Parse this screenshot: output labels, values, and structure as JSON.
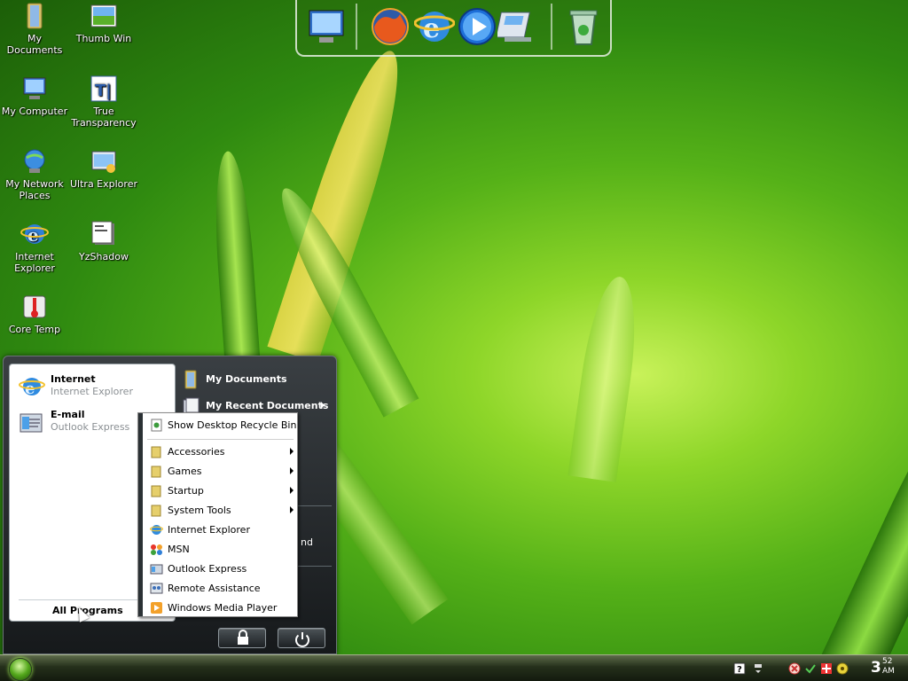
{
  "desktop_icons": [
    {
      "label": "My Documents",
      "icon": "folder-documents-icon"
    },
    {
      "label": "Thumb Win",
      "icon": "picture-icon"
    },
    {
      "label": "My Computer",
      "icon": "computer-icon"
    },
    {
      "label": "True Transparency",
      "icon": "app-icon"
    },
    {
      "label": "My Network Places",
      "icon": "network-icon"
    },
    {
      "label": "Ultra Explorer",
      "icon": "explorer-icon"
    },
    {
      "label": "Internet Explorer",
      "icon": "ie-icon"
    },
    {
      "label": "YzShadow",
      "icon": "shadow-app-icon"
    },
    {
      "label": "Core Temp",
      "icon": "thermometer-icon"
    }
  ],
  "dock": {
    "items": [
      "my-computer-icon",
      "firefox-icon",
      "internet-explorer-icon",
      "media-player-icon",
      "control-panel-icon",
      "recycle-bin-icon"
    ]
  },
  "start_menu": {
    "pinned": [
      {
        "title": "Internet",
        "subtitle": "Internet Explorer"
      },
      {
        "title": "E-mail",
        "subtitle": "Outlook Express"
      }
    ],
    "all_programs": "All Programs",
    "right_links": [
      {
        "label": "My Documents"
      },
      {
        "label": "My Recent Documents"
      }
    ],
    "partial_text": "nd"
  },
  "submenu": {
    "items": [
      {
        "label": "Show Desktop Recycle Bin",
        "has_arrow": false
      },
      {
        "label": "Accessories",
        "has_arrow": true
      },
      {
        "label": "Games",
        "has_arrow": true
      },
      {
        "label": "Startup",
        "has_arrow": true
      },
      {
        "label": "System Tools",
        "has_arrow": true
      },
      {
        "label": "Internet Explorer",
        "has_arrow": false
      },
      {
        "label": "MSN",
        "has_arrow": false
      },
      {
        "label": "Outlook Express",
        "has_arrow": false
      },
      {
        "label": "Remote Assistance",
        "has_arrow": false
      },
      {
        "label": "Windows Media Player",
        "has_arrow": false
      }
    ]
  },
  "taskbar": {
    "clock_hour": "3",
    "clock_minute": "52",
    "clock_ampm": "AM"
  },
  "colors": {
    "accent": "#54a81c",
    "menu_dark": "#1d2124"
  }
}
